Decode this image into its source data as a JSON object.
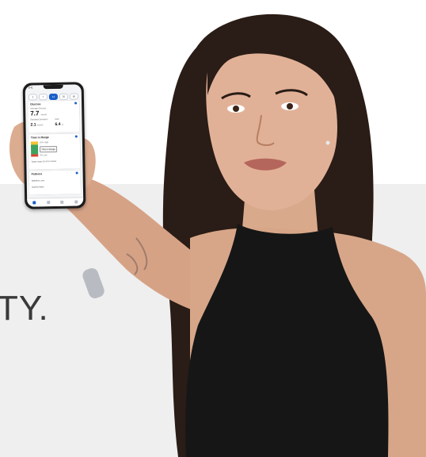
{
  "headline": "TY.",
  "phone": {
    "status_time": "9:41",
    "tabs": [
      "3",
      "7",
      "14",
      "30",
      "90"
    ],
    "active_tab": 2,
    "glucose_card": {
      "title": "Glucose",
      "avg_label": "Average Glucose",
      "avg_value": "7.7",
      "avg_unit": "mmol/L",
      "sd_label": "Standard Deviation",
      "sd_value": "2.1",
      "sd_unit": "mmol/L",
      "gmi_label": "GMI",
      "gmi_value": "6.4",
      "gmi_unit": "%"
    },
    "range_card": {
      "title": "Time in Range",
      "high_label": "10% High",
      "in_range_label": "74% in Range",
      "low_label": "3% Low",
      "note": "Target range 3.9–10.0 mmol/L"
    },
    "patterns_card": {
      "title": "Patterns",
      "row1": "Nighttime Lows",
      "row2": "Daytime Highs"
    }
  },
  "colors": {
    "accent": "#1a5fc7",
    "high": "#f2c230",
    "in_range": "#3da35d",
    "low": "#d9432f"
  }
}
